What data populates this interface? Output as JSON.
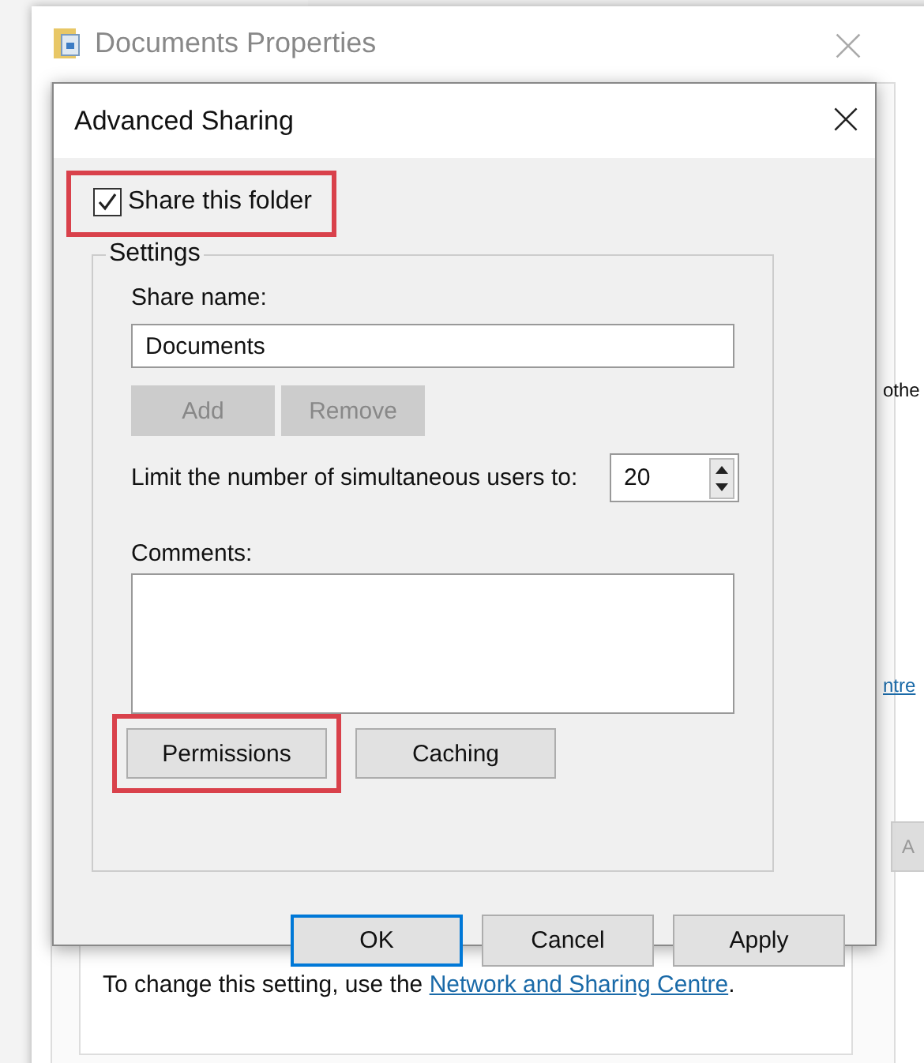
{
  "properties_window": {
    "title": "Documents Properties",
    "fragments": [
      {
        "text": "othe",
        "kind": "text"
      },
      {
        "text": "ntre",
        "kind": "link"
      },
      {
        "text": "A",
        "kind": "button"
      }
    ],
    "note": {
      "text": "To change this setting, use the ",
      "link": "Network and Sharing Centre",
      "end": "."
    }
  },
  "dialog": {
    "title": "Advanced Sharing",
    "share_checkbox": {
      "label": "Share this folder",
      "checked": true,
      "highlighted": true
    },
    "settings": {
      "legend": "Settings",
      "share_name_label": "Share name:",
      "share_name": "Documents",
      "buttons": [
        {
          "label": "Add",
          "disabled": true
        },
        {
          "label": "Remove",
          "disabled": true
        }
      ],
      "limit_label": "Limit the number of simultaneous users to:",
      "limit_value": "20",
      "comments_label": "Comments:",
      "actions": [
        {
          "label": "Permissions",
          "highlighted": true
        },
        {
          "label": "Caching",
          "highlighted": false
        }
      ]
    },
    "footer": [
      {
        "label": "OK",
        "selected": true
      },
      {
        "label": "Cancel",
        "selected": false
      },
      {
        "label": "Apply",
        "selected": false
      }
    ]
  }
}
